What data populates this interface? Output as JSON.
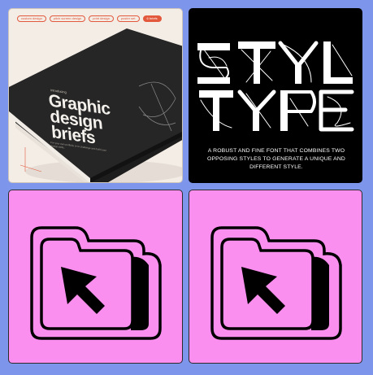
{
  "book_card": {
    "tags": [
      "custom design",
      "pitch screen design",
      "print design",
      "poster set"
    ],
    "active_tag": "6 briefs",
    "intro": "introducing",
    "title_lines": [
      "Graphic",
      "design",
      "briefs"
    ],
    "subtitle": "For your own portfolio or to challenge and build your design skills.",
    "accent_color": "#e2593d"
  },
  "font_card": {
    "description": "A ROBUST AND FINE FONT THAT COMBINES TWO OPPOSING STYLES TO GENERATE A UNIQUE AND DIFFERENT STYLE."
  },
  "folder_cards": [
    {
      "icon": "folder-cursor-icon",
      "background": "#fb8ff0"
    },
    {
      "icon": "folder-cursor-icon",
      "background": "#fb8ff0"
    }
  ],
  "colors": {
    "page_background": "#7d96ec",
    "font_card_background": "#000000",
    "book_card_background": "#f3ede6"
  }
}
